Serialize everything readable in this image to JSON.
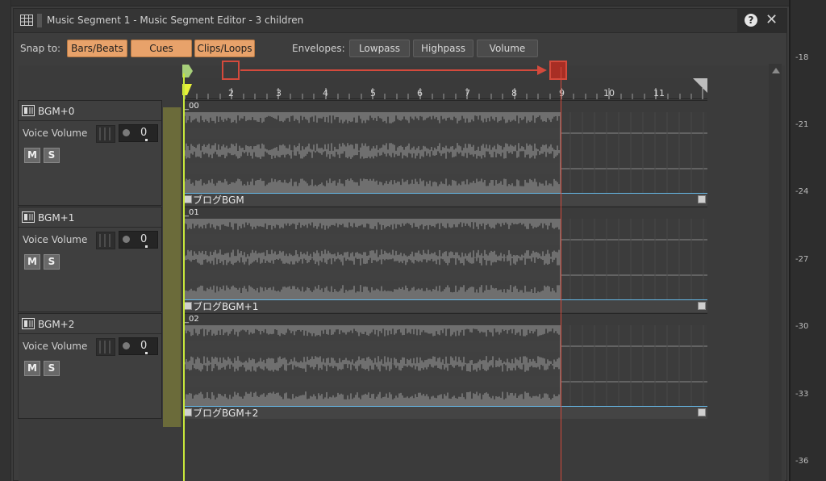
{
  "window": {
    "title": "Music Segment 1 - Music Segment Editor - 3 children",
    "help_glyph": "?",
    "close_glyph": "✕"
  },
  "toolbar": {
    "snap_label": "Snap to:",
    "snap_buttons": [
      {
        "label": "Bars/Beats",
        "active": true
      },
      {
        "label": "Cues",
        "active": true
      },
      {
        "label": "Clips/Loops",
        "active": true
      }
    ],
    "envelopes_label": "Envelopes:",
    "envelope_buttons": [
      "Lowpass",
      "Highpass",
      "Volume"
    ]
  },
  "ruler": {
    "numbers": [
      "2",
      "3",
      "4",
      "5",
      "6",
      "7",
      "8",
      "9",
      "10",
      "11"
    ]
  },
  "tracks": [
    {
      "name": "BGM+0",
      "param_label": "Voice Volume",
      "value": "0",
      "mute": "M",
      "solo": "S",
      "clip_id": "_00",
      "clip_label": "ブログBGM"
    },
    {
      "name": "BGM+1",
      "param_label": "Voice Volume",
      "value": "0",
      "mute": "M",
      "solo": "S",
      "clip_id": "_01",
      "clip_label": "ブログBGM+1"
    },
    {
      "name": "BGM+2",
      "param_label": "Voice Volume",
      "value": "0",
      "mute": "M",
      "solo": "S",
      "clip_id": "_02",
      "clip_label": "ブログBGM+2"
    }
  ],
  "meter": {
    "ticks": [
      "-18",
      "-21",
      "-24",
      "-27",
      "-30",
      "-33",
      "-36"
    ]
  },
  "colors": {
    "accent_orange": "#e8a26a",
    "annotation_red": "#d44a3c",
    "playhead": "#c8e83a",
    "clip_line": "#66b8e6"
  }
}
